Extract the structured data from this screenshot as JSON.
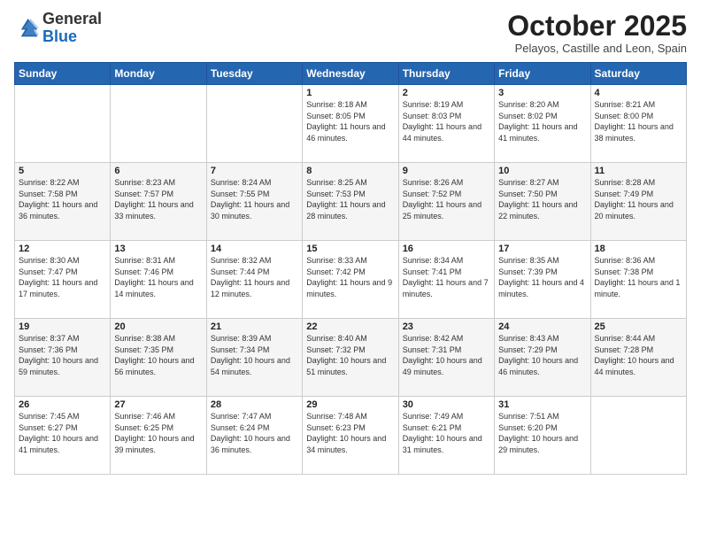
{
  "logo": {
    "general": "General",
    "blue": "Blue"
  },
  "header": {
    "month": "October 2025",
    "location": "Pelayos, Castille and Leon, Spain"
  },
  "weekdays": [
    "Sunday",
    "Monday",
    "Tuesday",
    "Wednesday",
    "Thursday",
    "Friday",
    "Saturday"
  ],
  "weeks": [
    [
      {
        "day": "",
        "sunrise": "",
        "sunset": "",
        "daylight": ""
      },
      {
        "day": "",
        "sunrise": "",
        "sunset": "",
        "daylight": ""
      },
      {
        "day": "",
        "sunrise": "",
        "sunset": "",
        "daylight": ""
      },
      {
        "day": "1",
        "sunrise": "Sunrise: 8:18 AM",
        "sunset": "Sunset: 8:05 PM",
        "daylight": "Daylight: 11 hours and 46 minutes."
      },
      {
        "day": "2",
        "sunrise": "Sunrise: 8:19 AM",
        "sunset": "Sunset: 8:03 PM",
        "daylight": "Daylight: 11 hours and 44 minutes."
      },
      {
        "day": "3",
        "sunrise": "Sunrise: 8:20 AM",
        "sunset": "Sunset: 8:02 PM",
        "daylight": "Daylight: 11 hours and 41 minutes."
      },
      {
        "day": "4",
        "sunrise": "Sunrise: 8:21 AM",
        "sunset": "Sunset: 8:00 PM",
        "daylight": "Daylight: 11 hours and 38 minutes."
      }
    ],
    [
      {
        "day": "5",
        "sunrise": "Sunrise: 8:22 AM",
        "sunset": "Sunset: 7:58 PM",
        "daylight": "Daylight: 11 hours and 36 minutes."
      },
      {
        "day": "6",
        "sunrise": "Sunrise: 8:23 AM",
        "sunset": "Sunset: 7:57 PM",
        "daylight": "Daylight: 11 hours and 33 minutes."
      },
      {
        "day": "7",
        "sunrise": "Sunrise: 8:24 AM",
        "sunset": "Sunset: 7:55 PM",
        "daylight": "Daylight: 11 hours and 30 minutes."
      },
      {
        "day": "8",
        "sunrise": "Sunrise: 8:25 AM",
        "sunset": "Sunset: 7:53 PM",
        "daylight": "Daylight: 11 hours and 28 minutes."
      },
      {
        "day": "9",
        "sunrise": "Sunrise: 8:26 AM",
        "sunset": "Sunset: 7:52 PM",
        "daylight": "Daylight: 11 hours and 25 minutes."
      },
      {
        "day": "10",
        "sunrise": "Sunrise: 8:27 AM",
        "sunset": "Sunset: 7:50 PM",
        "daylight": "Daylight: 11 hours and 22 minutes."
      },
      {
        "day": "11",
        "sunrise": "Sunrise: 8:28 AM",
        "sunset": "Sunset: 7:49 PM",
        "daylight": "Daylight: 11 hours and 20 minutes."
      }
    ],
    [
      {
        "day": "12",
        "sunrise": "Sunrise: 8:30 AM",
        "sunset": "Sunset: 7:47 PM",
        "daylight": "Daylight: 11 hours and 17 minutes."
      },
      {
        "day": "13",
        "sunrise": "Sunrise: 8:31 AM",
        "sunset": "Sunset: 7:46 PM",
        "daylight": "Daylight: 11 hours and 14 minutes."
      },
      {
        "day": "14",
        "sunrise": "Sunrise: 8:32 AM",
        "sunset": "Sunset: 7:44 PM",
        "daylight": "Daylight: 11 hours and 12 minutes."
      },
      {
        "day": "15",
        "sunrise": "Sunrise: 8:33 AM",
        "sunset": "Sunset: 7:42 PM",
        "daylight": "Daylight: 11 hours and 9 minutes."
      },
      {
        "day": "16",
        "sunrise": "Sunrise: 8:34 AM",
        "sunset": "Sunset: 7:41 PM",
        "daylight": "Daylight: 11 hours and 7 minutes."
      },
      {
        "day": "17",
        "sunrise": "Sunrise: 8:35 AM",
        "sunset": "Sunset: 7:39 PM",
        "daylight": "Daylight: 11 hours and 4 minutes."
      },
      {
        "day": "18",
        "sunrise": "Sunrise: 8:36 AM",
        "sunset": "Sunset: 7:38 PM",
        "daylight": "Daylight: 11 hours and 1 minute."
      }
    ],
    [
      {
        "day": "19",
        "sunrise": "Sunrise: 8:37 AM",
        "sunset": "Sunset: 7:36 PM",
        "daylight": "Daylight: 10 hours and 59 minutes."
      },
      {
        "day": "20",
        "sunrise": "Sunrise: 8:38 AM",
        "sunset": "Sunset: 7:35 PM",
        "daylight": "Daylight: 10 hours and 56 minutes."
      },
      {
        "day": "21",
        "sunrise": "Sunrise: 8:39 AM",
        "sunset": "Sunset: 7:34 PM",
        "daylight": "Daylight: 10 hours and 54 minutes."
      },
      {
        "day": "22",
        "sunrise": "Sunrise: 8:40 AM",
        "sunset": "Sunset: 7:32 PM",
        "daylight": "Daylight: 10 hours and 51 minutes."
      },
      {
        "day": "23",
        "sunrise": "Sunrise: 8:42 AM",
        "sunset": "Sunset: 7:31 PM",
        "daylight": "Daylight: 10 hours and 49 minutes."
      },
      {
        "day": "24",
        "sunrise": "Sunrise: 8:43 AM",
        "sunset": "Sunset: 7:29 PM",
        "daylight": "Daylight: 10 hours and 46 minutes."
      },
      {
        "day": "25",
        "sunrise": "Sunrise: 8:44 AM",
        "sunset": "Sunset: 7:28 PM",
        "daylight": "Daylight: 10 hours and 44 minutes."
      }
    ],
    [
      {
        "day": "26",
        "sunrise": "Sunrise: 7:45 AM",
        "sunset": "Sunset: 6:27 PM",
        "daylight": "Daylight: 10 hours and 41 minutes."
      },
      {
        "day": "27",
        "sunrise": "Sunrise: 7:46 AM",
        "sunset": "Sunset: 6:25 PM",
        "daylight": "Daylight: 10 hours and 39 minutes."
      },
      {
        "day": "28",
        "sunrise": "Sunrise: 7:47 AM",
        "sunset": "Sunset: 6:24 PM",
        "daylight": "Daylight: 10 hours and 36 minutes."
      },
      {
        "day": "29",
        "sunrise": "Sunrise: 7:48 AM",
        "sunset": "Sunset: 6:23 PM",
        "daylight": "Daylight: 10 hours and 34 minutes."
      },
      {
        "day": "30",
        "sunrise": "Sunrise: 7:49 AM",
        "sunset": "Sunset: 6:21 PM",
        "daylight": "Daylight: 10 hours and 31 minutes."
      },
      {
        "day": "31",
        "sunrise": "Sunrise: 7:51 AM",
        "sunset": "Sunset: 6:20 PM",
        "daylight": "Daylight: 10 hours and 29 minutes."
      },
      {
        "day": "",
        "sunrise": "",
        "sunset": "",
        "daylight": ""
      }
    ]
  ]
}
